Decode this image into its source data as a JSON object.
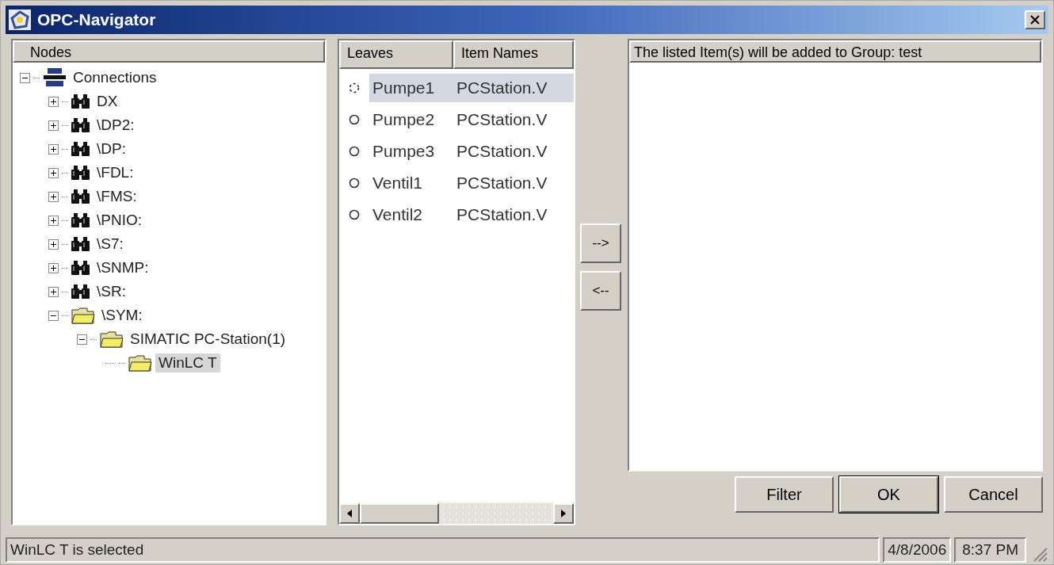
{
  "window": {
    "title": "OPC-Navigator"
  },
  "nodes_panel": {
    "header": "Nodes",
    "tree": [
      {
        "label": "Connections",
        "kind": "server",
        "expanded": true,
        "selected": false,
        "children": [
          {
            "label": "DX",
            "kind": "binoculars",
            "expanded": false,
            "selected": false
          },
          {
            "label": "\\DP2:",
            "kind": "binoculars",
            "expanded": false,
            "selected": false
          },
          {
            "label": "\\DP:",
            "kind": "binoculars",
            "expanded": false,
            "selected": false
          },
          {
            "label": "\\FDL:",
            "kind": "binoculars",
            "expanded": false,
            "selected": false
          },
          {
            "label": "\\FMS:",
            "kind": "binoculars",
            "expanded": false,
            "selected": false
          },
          {
            "label": "\\PNIO:",
            "kind": "binoculars",
            "expanded": false,
            "selected": false
          },
          {
            "label": "\\S7:",
            "kind": "binoculars",
            "expanded": false,
            "selected": false
          },
          {
            "label": "\\SNMP:",
            "kind": "binoculars",
            "expanded": false,
            "selected": false
          },
          {
            "label": "\\SR:",
            "kind": "binoculars",
            "expanded": false,
            "selected": false
          },
          {
            "label": "\\SYM:",
            "kind": "folder",
            "expanded": true,
            "selected": false,
            "children": [
              {
                "label": "SIMATIC PC-Station(1)",
                "kind": "folder",
                "expanded": true,
                "selected": false,
                "children": [
                  {
                    "label": "WinLC T",
                    "kind": "folder",
                    "selected": true
                  }
                ]
              }
            ]
          }
        ]
      }
    ]
  },
  "leaves_panel": {
    "columns": [
      "Leaves",
      "Item Names"
    ],
    "rows": [
      {
        "leaf": "Pumpe1",
        "item_name": "PCStation.V",
        "selected": true
      },
      {
        "leaf": "Pumpe2",
        "item_name": "PCStation.V",
        "selected": false
      },
      {
        "leaf": "Pumpe3",
        "item_name": "PCStation.V",
        "selected": false
      },
      {
        "leaf": "Ventil1",
        "item_name": "PCStation.V",
        "selected": false
      },
      {
        "leaf": "Ventil2",
        "item_name": "PCStation.V",
        "selected": false
      }
    ]
  },
  "transfer_buttons": [
    {
      "label": "-->"
    },
    {
      "label": "<--"
    }
  ],
  "group_panel": {
    "header": "The listed Item(s) will be added to Group: test"
  },
  "buttons": [
    {
      "label": "Filter",
      "default": false
    },
    {
      "label": "OK",
      "default": true
    },
    {
      "label": "Cancel",
      "default": false
    }
  ],
  "status_bar": {
    "message": "WinLC T is selected",
    "date": "4/8/2006",
    "time": "8:37 PM"
  }
}
